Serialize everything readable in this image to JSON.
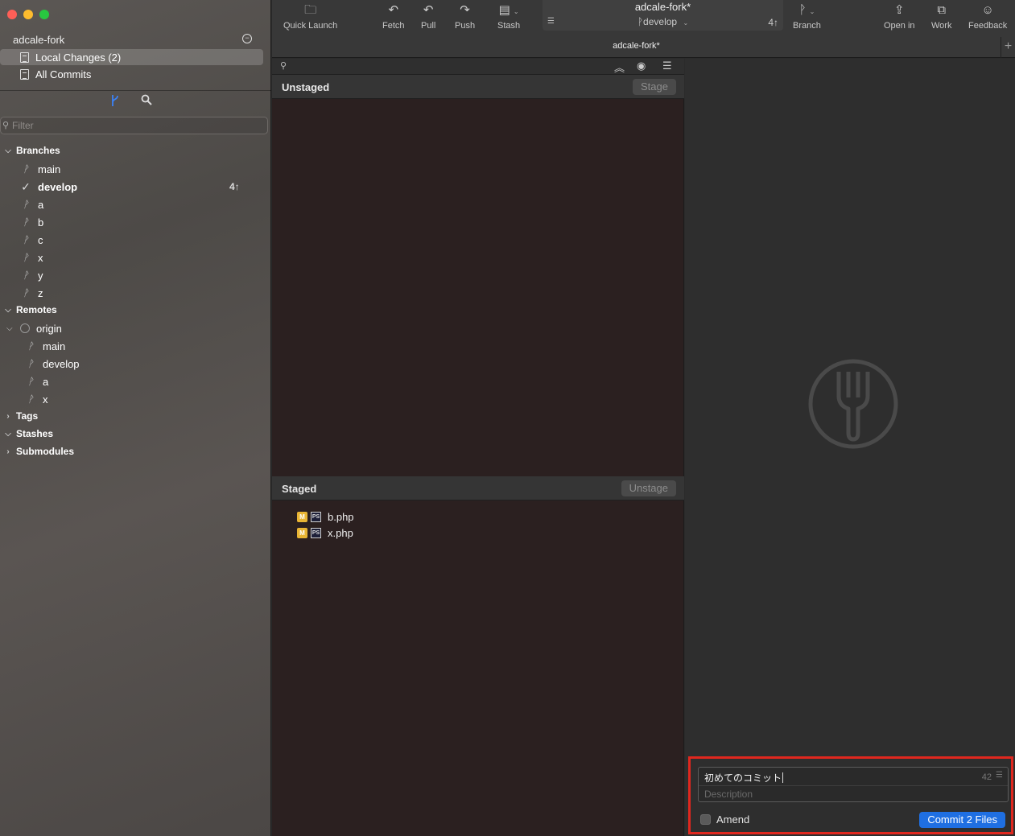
{
  "sidebar": {
    "repo_name": "adcale-fork",
    "nav": [
      {
        "label": "Local Changes (2)",
        "selected": true
      },
      {
        "label": "All Commits",
        "selected": false
      }
    ],
    "filter_placeholder": "Filter",
    "sections": {
      "branches": "Branches",
      "remotes": "Remotes",
      "tags": "Tags",
      "stashes": "Stashes",
      "submodules": "Submodules"
    },
    "branches": [
      {
        "name": "main"
      },
      {
        "name": "develop",
        "current": true,
        "ahead": "4↑"
      },
      {
        "name": "a"
      },
      {
        "name": "b"
      },
      {
        "name": "c"
      },
      {
        "name": "x"
      },
      {
        "name": "y"
      },
      {
        "name": "z"
      }
    ],
    "remote_name": "origin",
    "remote_branches": [
      "main",
      "develop",
      "a",
      "x"
    ]
  },
  "toolbar": {
    "quick_launch": "Quick Launch",
    "fetch": "Fetch",
    "pull": "Pull",
    "push": "Push",
    "stash": "Stash",
    "branch": "Branch",
    "open_in": "Open in",
    "work": "Work",
    "feedback": "Feedback",
    "title": "adcale-fork*",
    "current_branch": "develop",
    "ahead": "4↑",
    "tab": "adcale-fork*"
  },
  "changes": {
    "unstaged_title": "Unstaged",
    "stage_button": "Stage",
    "staged_title": "Staged",
    "unstage_button": "Unstage",
    "staged_files": [
      {
        "status": "M",
        "type": "PS",
        "name": "b.php"
      },
      {
        "status": "M",
        "type": "PS",
        "name": "x.php"
      }
    ]
  },
  "commit": {
    "summary": "初めてのコミット",
    "char_count": "42",
    "description_placeholder": "Description",
    "amend_label": "Amend",
    "button_label": "Commit 2 Files"
  },
  "colors": {
    "accent": "#1f6fe2",
    "highlight_border": "#e0271e",
    "modified_badge": "#e9b534"
  }
}
